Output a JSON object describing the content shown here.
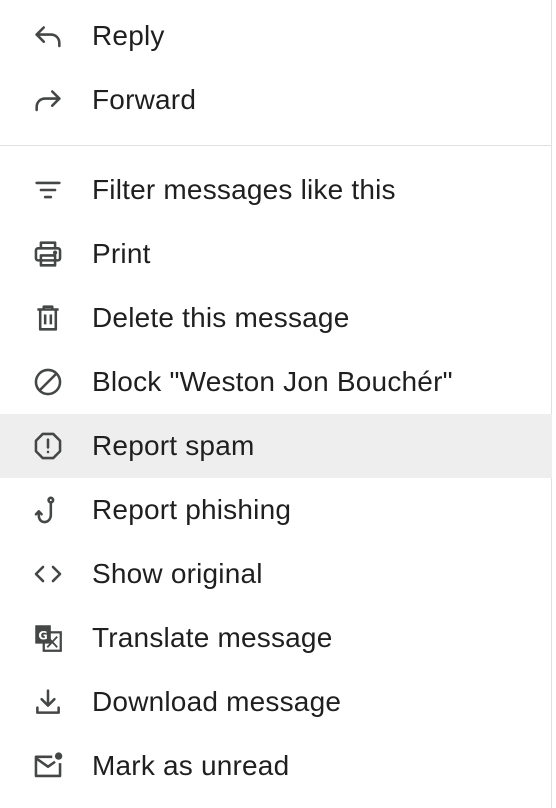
{
  "menu": {
    "items": [
      {
        "id": "reply",
        "label": "Reply",
        "icon": "reply-icon"
      },
      {
        "id": "forward",
        "label": "Forward",
        "icon": "forward-icon"
      },
      {
        "id": "filter",
        "label": "Filter messages like this",
        "icon": "filter-icon"
      },
      {
        "id": "print",
        "label": "Print",
        "icon": "print-icon"
      },
      {
        "id": "delete",
        "label": "Delete this message",
        "icon": "trash-icon"
      },
      {
        "id": "block",
        "label": "Block \"Weston Jon Bouchér\"",
        "icon": "block-icon"
      },
      {
        "id": "report-spam",
        "label": "Report spam",
        "icon": "report-icon",
        "highlighted": true
      },
      {
        "id": "report-phishing",
        "label": "Report phishing",
        "icon": "fishhook-icon"
      },
      {
        "id": "show-original",
        "label": "Show original",
        "icon": "code-icon"
      },
      {
        "id": "translate",
        "label": "Translate message",
        "icon": "translate-icon"
      },
      {
        "id": "download",
        "label": "Download message",
        "icon": "download-icon"
      },
      {
        "id": "mark-unread",
        "label": "Mark as unread",
        "icon": "mark-unread-icon"
      }
    ]
  },
  "colors": {
    "text": "#1f1f1f",
    "icon": "#444746",
    "hover_background": "#eeeeee",
    "divider": "#e0e0e0"
  }
}
